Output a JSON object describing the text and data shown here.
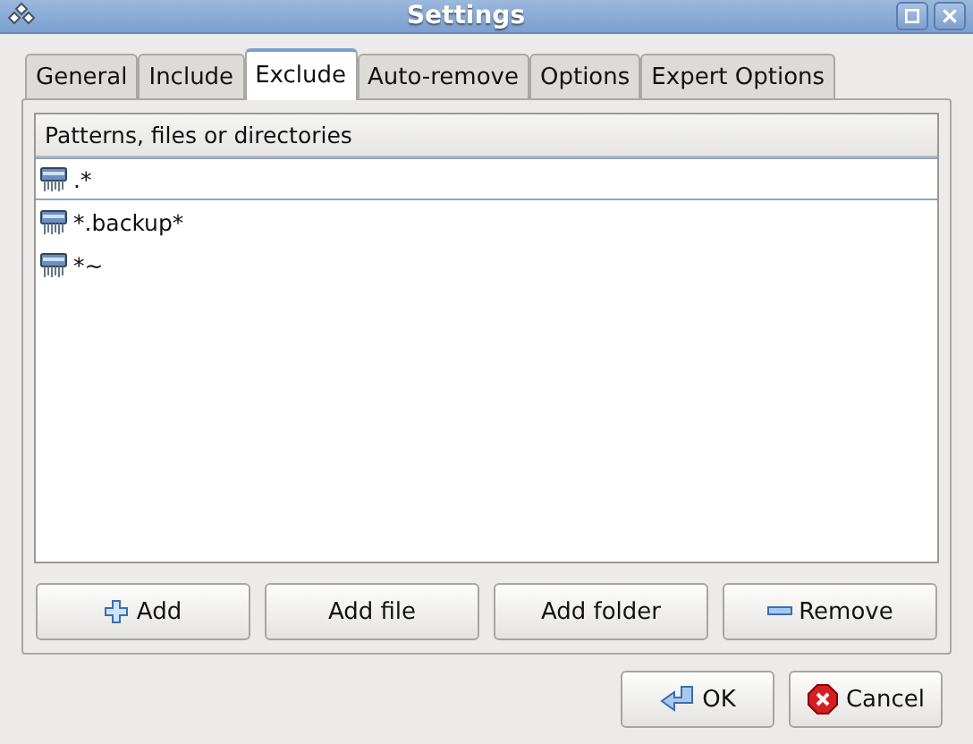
{
  "window": {
    "title": "Settings"
  },
  "tabs": [
    {
      "label": "General",
      "selected": false
    },
    {
      "label": "Include",
      "selected": false
    },
    {
      "label": "Exclude",
      "selected": true
    },
    {
      "label": "Auto-remove",
      "selected": false
    },
    {
      "label": "Options",
      "selected": false
    },
    {
      "label": "Expert Options",
      "selected": false
    }
  ],
  "list": {
    "column": "Patterns, files or directories",
    "rows": [
      {
        "text": ".*",
        "selected": true
      },
      {
        "text": "*.backup*",
        "selected": false
      },
      {
        "text": "*~",
        "selected": false
      }
    ]
  },
  "list_buttons": [
    {
      "label": "Add",
      "kind": "add"
    },
    {
      "label": "Add file",
      "kind": "plain"
    },
    {
      "label": "Add folder",
      "kind": "plain"
    },
    {
      "label": "Remove",
      "kind": "remove"
    }
  ],
  "dialog_buttons": [
    {
      "label": "OK",
      "kind": "ok"
    },
    {
      "label": "Cancel",
      "kind": "cancel"
    }
  ]
}
